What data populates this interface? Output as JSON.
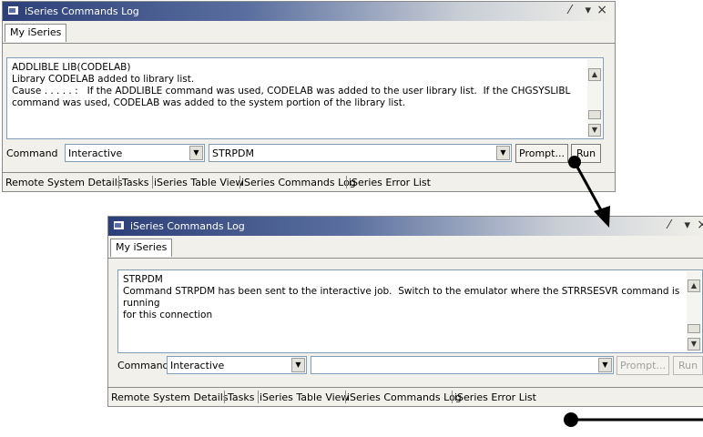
{
  "window1": {
    "title": "iSeries Commands Log",
    "controls": {
      "pin": "⁄",
      "menu": "▾",
      "close": "×"
    },
    "tab": "My iSeries",
    "log_text": "ADDLIBLE LIB(CODELAB)\nLibrary CODELAB added to library list.\nCause . . . . . :   If the ADDLIBLE command was used, CODELAB was added to the user library list.  If the CHGSYSLIBL\ncommand was used, CODELAB was added to the system portion of the library list.",
    "command_label": "Command",
    "mode_value": "Interactive",
    "command_value": "STRPDM",
    "prompt_label": "Prompt...",
    "run_label": "Run",
    "view_tabs": [
      "Remote System Details",
      "Tasks",
      "iSeries Table View",
      "iSeries Commands Log",
      "iSeries Error List"
    ]
  },
  "window2": {
    "title": "iSeries Commands Log",
    "controls": {
      "pin": "⁄",
      "menu": "▾",
      "close": "×"
    },
    "tab": "My iSeries",
    "log_text": "STRPDM\nCommand STRPDM has been sent to the interactive job.  Switch to the emulator where the STRRSESVR command is running\nfor this connection",
    "command_label": "Command",
    "mode_value": "Interactive",
    "command_value": "",
    "prompt_label": "Prompt...",
    "run_label": "Run",
    "view_tabs": [
      "Remote System Details",
      "Tasks",
      "iSeries Table View",
      "iSeries Commands Log",
      "iSeries Error List"
    ]
  },
  "colors": {
    "titlebar_dark": "#2c3f78",
    "panel_bg": "#f1f0ea",
    "border": "#8a8a8a"
  },
  "icons": {
    "window": "window-icon",
    "scroll_up": "scroll-up-arrow-icon",
    "scroll_down": "scroll-down-arrow-icon",
    "dropdown": "chevron-down-icon"
  }
}
